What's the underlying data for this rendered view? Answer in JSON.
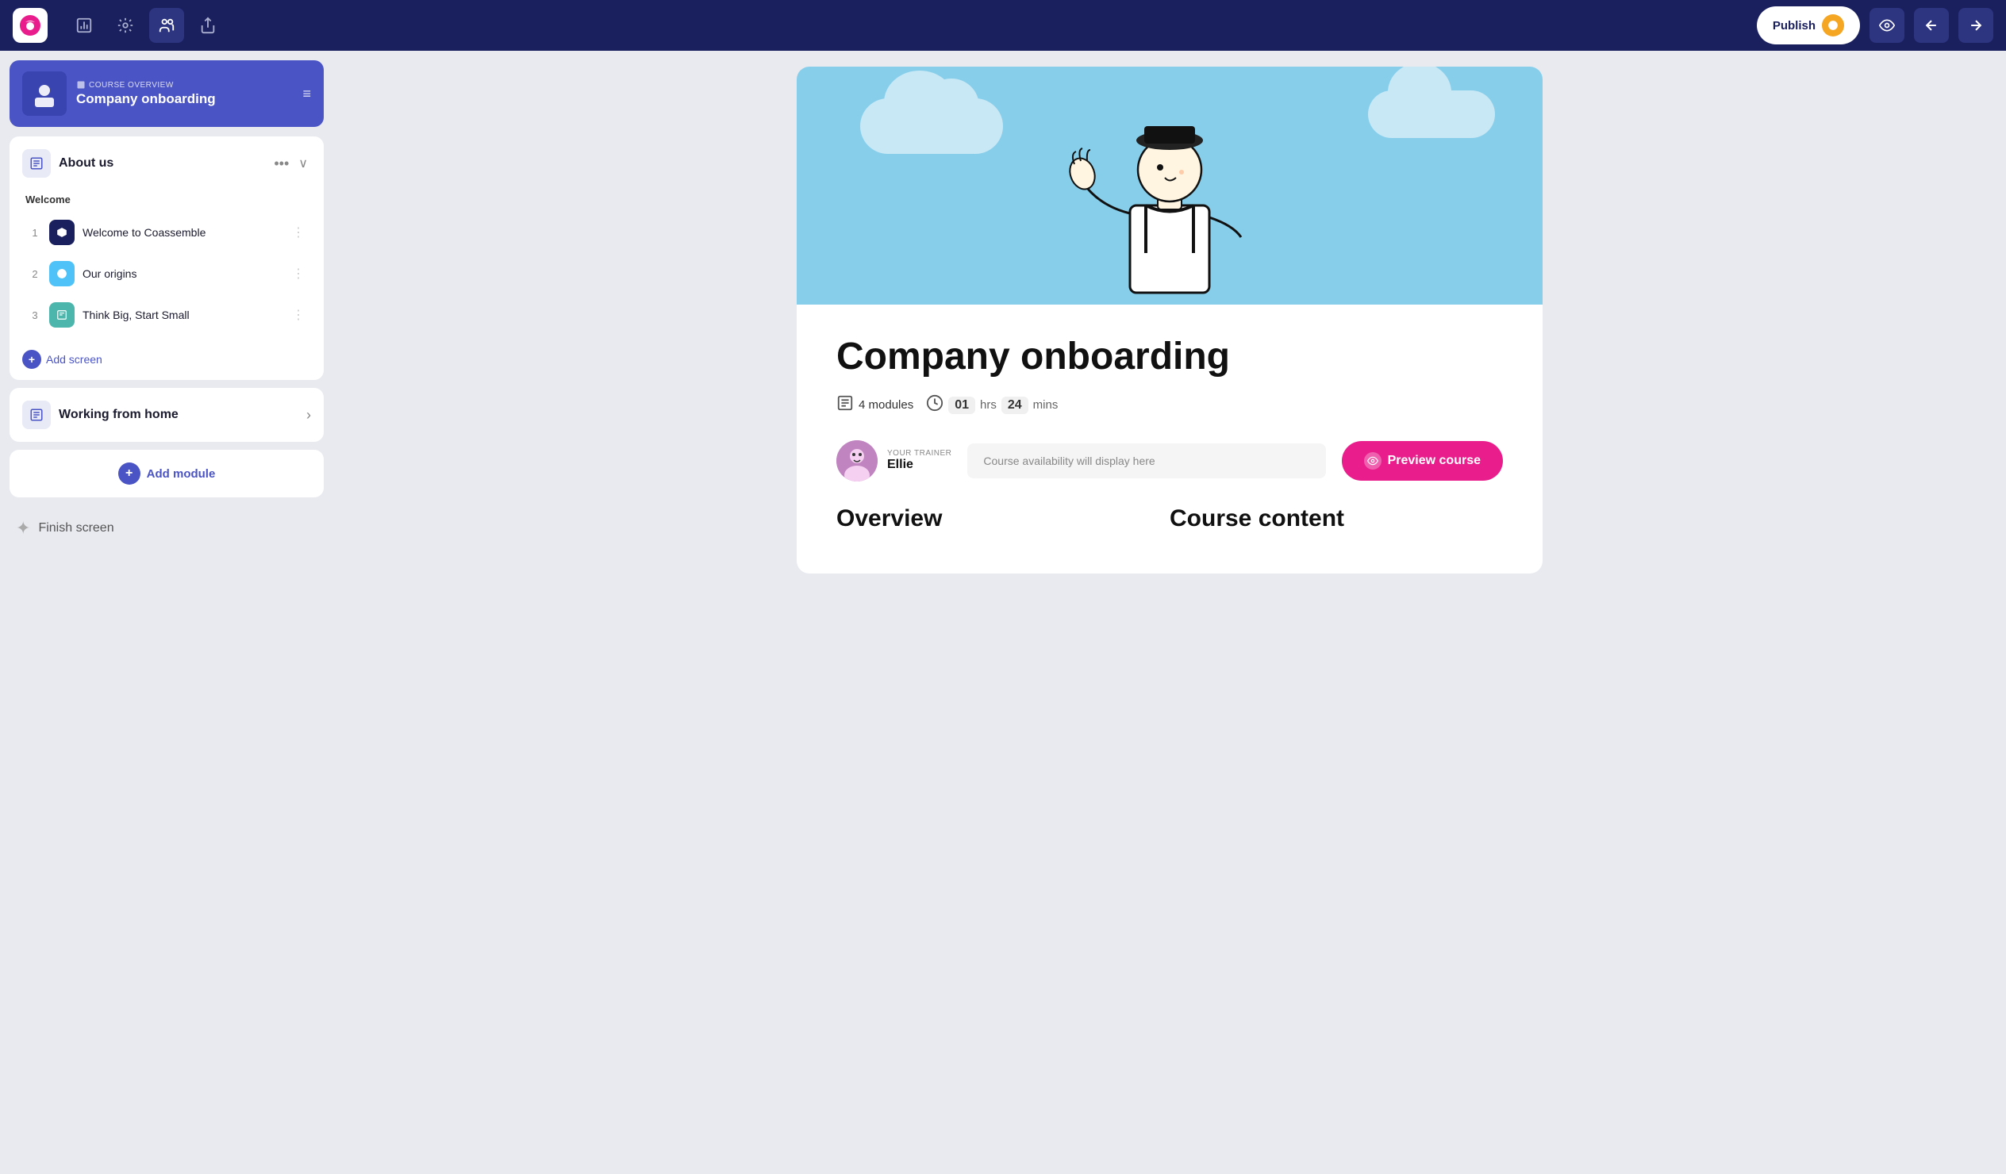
{
  "topbar": {
    "icons": [
      {
        "name": "analytics-icon",
        "label": "Analytics"
      },
      {
        "name": "settings-icon",
        "label": "Settings"
      },
      {
        "name": "team-icon",
        "label": "Team"
      },
      {
        "name": "share-icon",
        "label": "Share"
      }
    ],
    "publish_label": "Publish",
    "nav_back_label": "Back",
    "nav_forward_label": "Forward"
  },
  "sidebar": {
    "course_overview_label": "COURSE OVERVIEW",
    "course_title": "Company onboarding",
    "modules": [
      {
        "id": "about-us",
        "title": "About us",
        "expanded": true,
        "lesson_groups": [
          {
            "label": "Welcome",
            "lessons": [
              {
                "num": "1",
                "title": "Welcome to Coassemble",
                "icon_type": "dark"
              },
              {
                "num": "2",
                "title": "Our origins",
                "icon_type": "blue"
              },
              {
                "num": "3",
                "title": "Think Big, Start Small",
                "icon_type": "teal"
              }
            ]
          }
        ],
        "add_screen_label": "Add screen"
      },
      {
        "id": "working-from-home",
        "title": "Working from home",
        "expanded": false
      }
    ],
    "add_module_label": "Add module",
    "finish_screen_label": "Finish screen"
  },
  "preview": {
    "course_title": "Company onboarding",
    "modules_count": "4 modules",
    "hours": "01",
    "hrs_label": "hrs",
    "mins": "24",
    "mins_label": "mins",
    "trainer_label": "YOUR TRAINER",
    "trainer_name": "Ellie",
    "availability_placeholder": "Course availability will display here",
    "preview_button_label": "Preview course",
    "overview_label": "Overview",
    "course_content_label": "Course content"
  }
}
